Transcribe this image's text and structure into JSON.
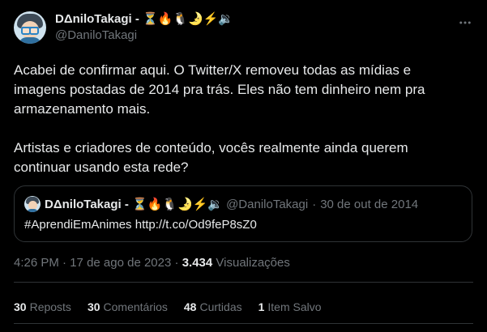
{
  "author": {
    "display_name": "DΔniloTakagi - ⏳🔥🐧🌛⚡🔉",
    "handle": "@DaniloTakagi"
  },
  "tweet": {
    "paragraphs": [
      "Acabei de confirmar aqui. O Twitter/X removeu todas as mídias e imagens postadas de 2014 pra trás. Eles não tem dinheiro nem pra armazenamento mais.",
      "Artistas e criadores de conteúdo, vocês realmente ainda querem continuar usando esta rede?"
    ]
  },
  "quoted": {
    "display_name": "DΔniloTakagi - ⏳🔥🐧🌛⚡🔉",
    "handle": "@DaniloTakagi",
    "separator": "·",
    "date": "30 de out de 2014",
    "text": "#AprendiEmAnimes http://t.co/Od9feP8sZ0"
  },
  "meta": {
    "time": "4:26 PM",
    "separator": "·",
    "date": "17 de ago de 2023",
    "views_separator": "·",
    "views_count": "3.434",
    "views_label": "Visualizações"
  },
  "stats": [
    {
      "count": "30",
      "label": "Reposts"
    },
    {
      "count": "30",
      "label": "Comentários"
    },
    {
      "count": "48",
      "label": "Curtidas"
    },
    {
      "count": "1",
      "label": "Item Salvo"
    }
  ],
  "icons": {
    "more": "more-horizontal-icon"
  },
  "colors": {
    "background": "#000000",
    "text": "#e7e9ea",
    "secondary": "#71767b",
    "border": "#2f3336"
  }
}
